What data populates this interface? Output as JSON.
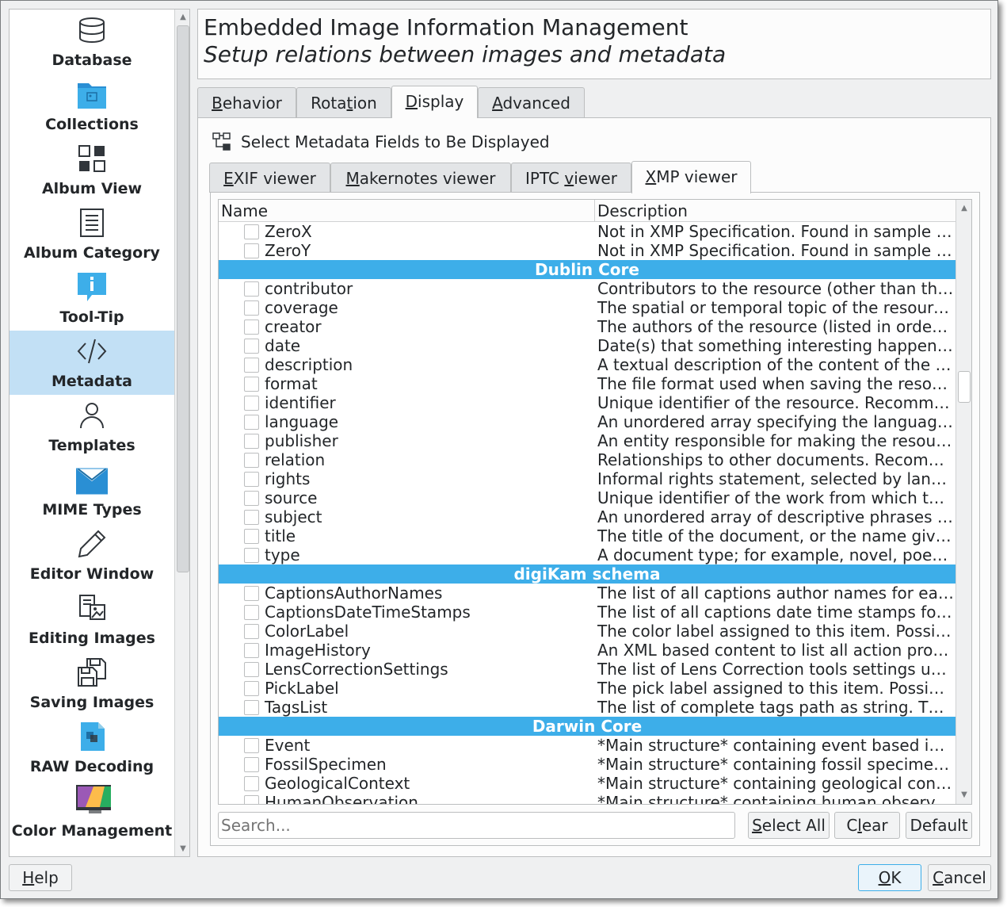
{
  "sidebar": {
    "items": [
      {
        "label": "Database",
        "icon": "database-icon"
      },
      {
        "label": "Collections",
        "icon": "folder-icon"
      },
      {
        "label": "Album View",
        "icon": "grid-icon"
      },
      {
        "label": "Album Category",
        "icon": "list-icon"
      },
      {
        "label": "Tool-Tip",
        "icon": "info-icon"
      },
      {
        "label": "Metadata",
        "icon": "code-icon",
        "selected": true
      },
      {
        "label": "Templates",
        "icon": "user-icon"
      },
      {
        "label": "MIME Types",
        "icon": "mail-icon"
      },
      {
        "label": "Editor Window",
        "icon": "pencil-icon"
      },
      {
        "label": "Editing Images",
        "icon": "image-edit-icon"
      },
      {
        "label": "Saving Images",
        "icon": "save-icon"
      },
      {
        "label": "RAW Decoding",
        "icon": "raw-icon"
      },
      {
        "label": "Color Management",
        "icon": "monitor-color-icon"
      }
    ]
  },
  "header": {
    "title": "Embedded Image Information Management",
    "subtitle": "Setup relations between images and metadata"
  },
  "tabs": {
    "behavior": {
      "pre": "",
      "u": "B",
      "post": "ehavior"
    },
    "rotation": {
      "pre": "Rota",
      "u": "t",
      "post": "ion"
    },
    "display": {
      "pre": "",
      "u": "D",
      "post": "isplay"
    },
    "advanced": {
      "pre": "",
      "u": "A",
      "post": "dvanced"
    },
    "active": "Display"
  },
  "display": {
    "section_label": "Select Metadata Fields to Be Displayed"
  },
  "viewer_tabs": {
    "exif": {
      "pre": "",
      "u": "E",
      "post": "XIF viewer"
    },
    "makernotes": {
      "pre": "",
      "u": "M",
      "post": "akernotes viewer"
    },
    "iptc": {
      "pre": "IPTC ",
      "u": "v",
      "post": "iewer"
    },
    "xmp": {
      "pre": "",
      "u": "X",
      "post": "MP viewer"
    },
    "active": "XMP viewer"
  },
  "table": {
    "columns": [
      "Name",
      "Description"
    ],
    "rows": [
      {
        "type": "item",
        "name": "ZeroX",
        "desc": "Not in XMP Specification. Found in sample files."
      },
      {
        "type": "item",
        "name": "ZeroY",
        "desc": "Not in XMP Specification. Found in sample files."
      },
      {
        "type": "group",
        "name": "Dublin Core"
      },
      {
        "type": "item",
        "name": "contributor",
        "desc": "Contributors to the resource (other than the authors)."
      },
      {
        "type": "item",
        "name": "coverage",
        "desc": "The spatial or temporal topic of the resource, the location."
      },
      {
        "type": "item",
        "name": "creator",
        "desc": "The authors of the resource (listed in order of precedence)."
      },
      {
        "type": "item",
        "name": "date",
        "desc": "Date(s) that something interesting happened to the resource."
      },
      {
        "type": "item",
        "name": "description",
        "desc": "A textual description of the content of the resource."
      },
      {
        "type": "item",
        "name": "format",
        "desc": "The file format used when saving the resource."
      },
      {
        "type": "item",
        "name": "identifier",
        "desc": "Unique identifier of the resource. Recommended best practice."
      },
      {
        "type": "item",
        "name": "language",
        "desc": "An unordered array specifying the languages used in the resource."
      },
      {
        "type": "item",
        "name": "publisher",
        "desc": "An entity responsible for making the resource available."
      },
      {
        "type": "item",
        "name": "relation",
        "desc": "Relationships to other documents. Recommended best practice."
      },
      {
        "type": "item",
        "name": "rights",
        "desc": "Informal rights statement, selected by language."
      },
      {
        "type": "item",
        "name": "source",
        "desc": "Unique identifier of the work from which this resource was derived."
      },
      {
        "type": "item",
        "name": "subject",
        "desc": "An unordered array of descriptive phrases or keywords."
      },
      {
        "type": "item",
        "name": "title",
        "desc": "The title of the document, or the name given to the resource."
      },
      {
        "type": "item",
        "name": "type",
        "desc": "A document type; for example, novel, poem, or working paper."
      },
      {
        "type": "group",
        "name": "digiKam schema"
      },
      {
        "type": "item",
        "name": "CaptionsAuthorNames",
        "desc": "The list of all captions author names for each language alternative."
      },
      {
        "type": "item",
        "name": "CaptionsDateTimeStamps",
        "desc": "The list of all captions date time stamps for each language alternative."
      },
      {
        "type": "item",
        "name": "ColorLabel",
        "desc": "The color label assigned to this item. Possible values."
      },
      {
        "type": "item",
        "name": "ImageHistory",
        "desc": "An XML based content to list all action processed on this item."
      },
      {
        "type": "item",
        "name": "LensCorrectionSettings",
        "desc": "The list of Lens Correction tools settings used to fix lens aberration."
      },
      {
        "type": "item",
        "name": "PickLabel",
        "desc": "The pick label assigned to this item. Possible values."
      },
      {
        "type": "item",
        "name": "TagsList",
        "desc": "The list of complete tags path as string. The path hierarchy."
      },
      {
        "type": "group",
        "name": "Darwin Core"
      },
      {
        "type": "item",
        "name": "Event",
        "desc": "*Main structure* containing event based information."
      },
      {
        "type": "item",
        "name": "FossilSpecimen",
        "desc": "*Main structure* containing fossil specimen information."
      },
      {
        "type": "item",
        "name": "GeologicalContext",
        "desc": "*Main structure* containing geological context information."
      },
      {
        "type": "item",
        "name": "HumanObservation",
        "desc": "*Main structure* containing human observation information."
      }
    ]
  },
  "search": {
    "placeholder": "Search..."
  },
  "buttons": {
    "select_all": {
      "pre": "",
      "u": "S",
      "post": "elect All"
    },
    "clear": {
      "pre": "C",
      "u": "l",
      "post": "ear"
    },
    "default": {
      "pre": "",
      "u": "",
      "post": "Default"
    },
    "help": {
      "pre": "",
      "u": "H",
      "post": "elp"
    },
    "ok": {
      "pre": "",
      "u": "O",
      "post": "K"
    },
    "cancel": {
      "pre": "",
      "u": "C",
      "post": "ancel"
    }
  },
  "colors": {
    "accent": "#3daee9",
    "selection": "#c2e0f5"
  }
}
